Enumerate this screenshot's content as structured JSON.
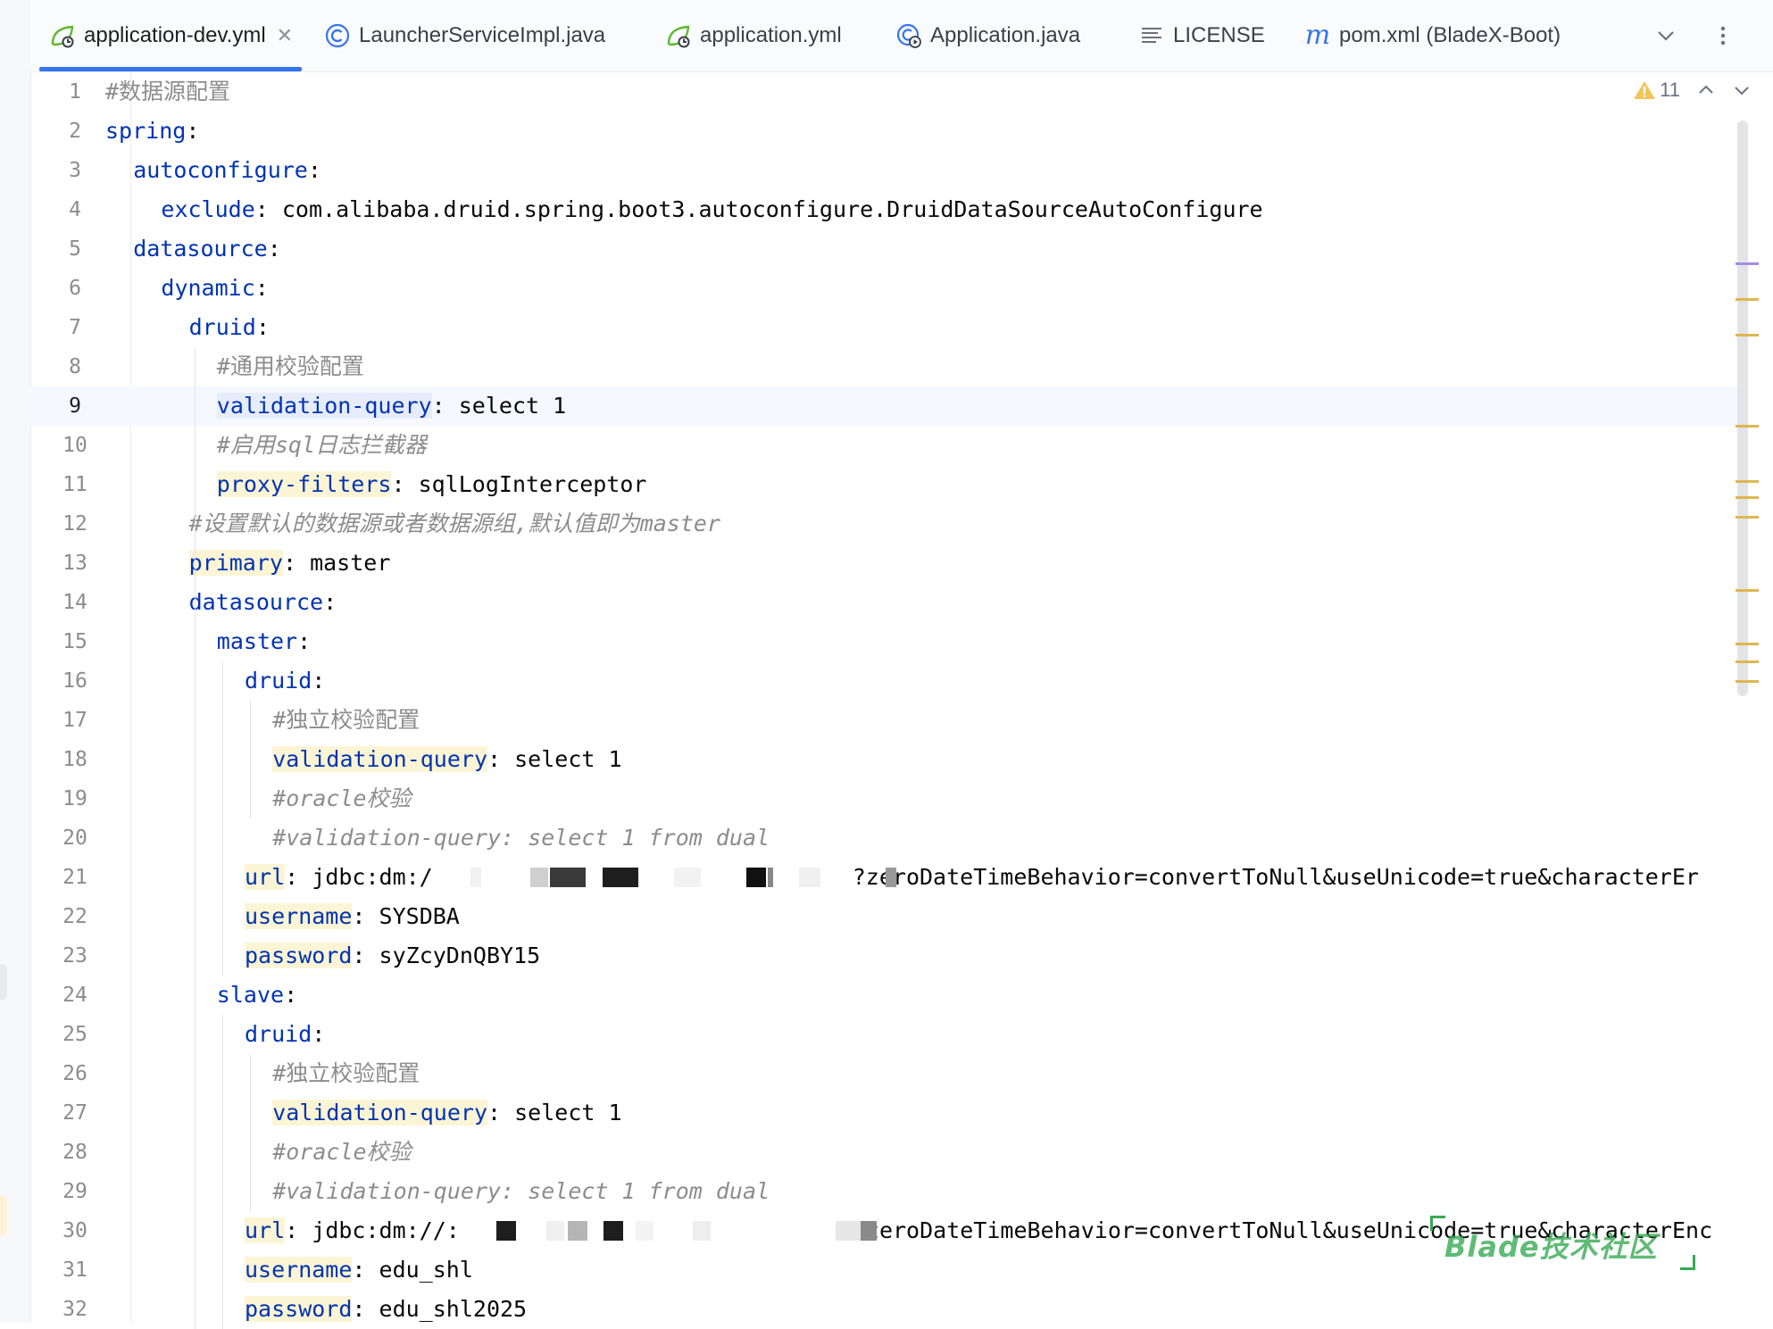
{
  "tabs": [
    {
      "label": "application-dev.yml",
      "icon": "yaml-spring-icon",
      "active": true,
      "closable": true
    },
    {
      "label": "LauncherServiceImpl.java",
      "icon": "java-class-icon"
    },
    {
      "label": "application.yml",
      "icon": "yaml-spring-icon"
    },
    {
      "label": "Application.java",
      "icon": "java-run-class-icon"
    },
    {
      "label": "LICENSE",
      "icon": "text-file-icon"
    },
    {
      "label": "pom.xml (BladeX-Boot)",
      "icon": "maven-icon"
    }
  ],
  "tab_actions": {
    "more_tabs_icon": "chevron-down-icon",
    "menu_icon": "more-vertical-icon"
  },
  "inspection": {
    "warning_count": "11",
    "icon": "warning-icon",
    "prev_icon": "chevron-up-icon",
    "next_icon": "chevron-down-icon"
  },
  "current_line": 9,
  "colors": {
    "keyword": "#0033b3",
    "comment": "#8c8c8c",
    "text": "#080808",
    "key_highlight": "#fcf5d5",
    "warning_stripe": "#e0b650",
    "watermark": "#38aa54"
  },
  "code_lines": [
    {
      "num": "1",
      "key": "",
      "sep": "",
      "value": "",
      "comment": "#数据源配置"
    },
    {
      "num": "2",
      "key": "spring",
      "sep": ":",
      "value": "",
      "comment": ""
    },
    {
      "num": "3",
      "key": "autoconfigure",
      "sep": ":",
      "value": "",
      "comment": ""
    },
    {
      "num": "4",
      "key": "exclude",
      "sep": ":",
      "value": " com.alibaba.druid.spring.boot3.autoconfigure.DruidDataSourceAutoConfigure",
      "comment": ""
    },
    {
      "num": "5",
      "key": "datasource",
      "sep": ":",
      "value": "",
      "comment": ""
    },
    {
      "num": "6",
      "key": "dynamic",
      "sep": ":",
      "value": "",
      "comment": ""
    },
    {
      "num": "7",
      "key": "druid",
      "sep": ":",
      "value": "",
      "comment": ""
    },
    {
      "num": "8",
      "key": "",
      "sep": "",
      "value": "",
      "comment": "#通用校验配置"
    },
    {
      "num": "9",
      "key": "validation-query",
      "sep": ":",
      "value": " select 1",
      "comment": ""
    },
    {
      "num": "10",
      "key": "",
      "sep": "",
      "value": "",
      "comment": "#启用sql日志拦截器"
    },
    {
      "num": "11",
      "key": "proxy-filters",
      "sep": ":",
      "value": " sqlLogInterceptor",
      "comment": ""
    },
    {
      "num": "12",
      "key": "",
      "sep": "",
      "value": "",
      "comment": "#设置默认的数据源或者数据源组,默认值即为master"
    },
    {
      "num": "13",
      "key": "primary",
      "sep": ":",
      "value": " master",
      "comment": ""
    },
    {
      "num": "14",
      "key": "datasource",
      "sep": ":",
      "value": "",
      "comment": ""
    },
    {
      "num": "15",
      "key": "master",
      "sep": ":",
      "value": "",
      "comment": ""
    },
    {
      "num": "16",
      "key": "druid",
      "sep": ":",
      "value": "",
      "comment": ""
    },
    {
      "num": "17",
      "key": "",
      "sep": "",
      "value": "",
      "comment": "#独立校验配置"
    },
    {
      "num": "18",
      "key": "validation-query",
      "sep": ":",
      "value": " select 1",
      "comment": ""
    },
    {
      "num": "19",
      "key": "",
      "sep": "",
      "value": "",
      "comment": "#oracle校验"
    },
    {
      "num": "20",
      "key": "",
      "sep": "",
      "value": "",
      "comment": "#validation-query: select 1 from dual"
    },
    {
      "num": "21",
      "key": "url",
      "sep": ":",
      "value": " jdbc:dm:/",
      "tail": "?zeroDateTimeBehavior=convertToNull&useUnicode=true&characterEr",
      "comment": ""
    },
    {
      "num": "22",
      "key": "username",
      "sep": ":",
      "value": " SYSDBA",
      "comment": ""
    },
    {
      "num": "23",
      "key": "password",
      "sep": ":",
      "value": " syZcyDnQBY15",
      "comment": ""
    },
    {
      "num": "24",
      "key": "slave",
      "sep": ":",
      "value": "",
      "comment": ""
    },
    {
      "num": "25",
      "key": "druid",
      "sep": ":",
      "value": "",
      "comment": ""
    },
    {
      "num": "26",
      "key": "",
      "sep": "",
      "value": "",
      "comment": "#独立校验配置"
    },
    {
      "num": "27",
      "key": "validation-query",
      "sep": ":",
      "value": " select 1",
      "comment": ""
    },
    {
      "num": "28",
      "key": "",
      "sep": "",
      "value": "",
      "comment": "#oracle校验"
    },
    {
      "num": "29",
      "key": "",
      "sep": "",
      "value": "",
      "comment": "#validation-query: select 1 from dual"
    },
    {
      "num": "30",
      "key": "url",
      "sep": ":",
      "value": " jdbc:dm://:",
      "tail": "?zeroDateTimeBehavior=convertToNull&useUnicode=true&characterEnc",
      "comment": ""
    },
    {
      "num": "31",
      "key": "username",
      "sep": ":",
      "value": " edu_shl",
      "comment": ""
    },
    {
      "num": "32",
      "key": "password",
      "sep": ":",
      "value": " edu_shl2025",
      "comment": ""
    }
  ],
  "watermark": "Blade技术社区"
}
